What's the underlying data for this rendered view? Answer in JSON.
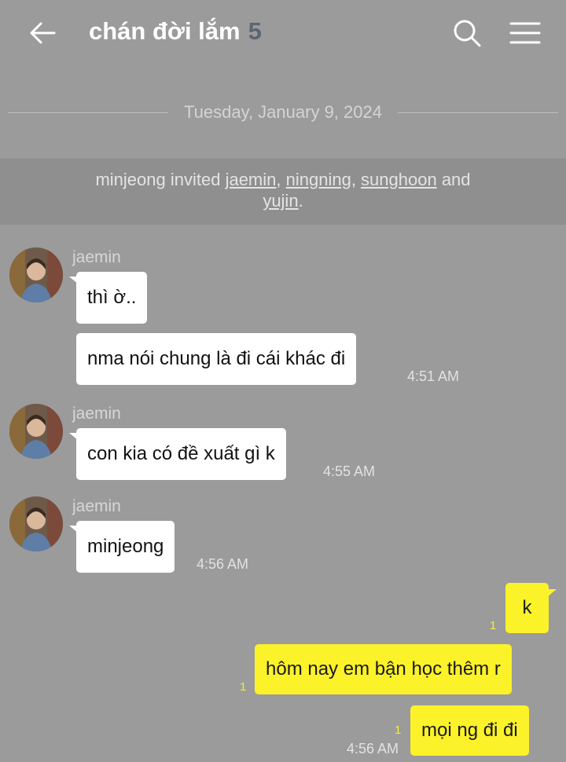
{
  "header": {
    "title": "chán đời lắm",
    "member_count": "5",
    "back_icon": "arrow-left-icon",
    "search_icon": "search-icon",
    "menu_icon": "menu-icon"
  },
  "date_divider": "Tuesday, January 9, 2024",
  "system_notice": {
    "inviter": "minjeong",
    "invited_text": " invited ",
    "invitees": [
      "jaemin",
      "ningning",
      "sunghoon",
      "yujin"
    ],
    "sep_comma": ", ",
    "sep_and": " and ",
    "end": "."
  },
  "messages": [
    {
      "sender": "jaemin",
      "bubbles": [
        "thì ờ..",
        "nma nói chung là đi cái khác đi"
      ],
      "time": "4:51 AM"
    },
    {
      "sender": "jaemin",
      "bubbles": [
        "con kia có đề xuất gì k"
      ],
      "time": "4:55 AM"
    },
    {
      "sender": "jaemin",
      "bubbles": [
        "minjeong"
      ],
      "time": "4:56 AM"
    }
  ],
  "my_messages": [
    {
      "text": "k",
      "unread": "1"
    },
    {
      "text": "hôm nay em bận học thêm r",
      "unread": "1"
    },
    {
      "text": "mọi ng đi đi",
      "unread": "1",
      "time": "4:56 AM"
    }
  ],
  "colors": {
    "background": "#9b9b9b",
    "my_bubble": "#fbf22a",
    "other_bubble": "#ffffff",
    "unread": "#f7ef2b",
    "member_count": "#5d6570"
  }
}
